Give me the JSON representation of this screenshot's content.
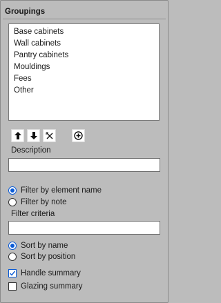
{
  "groupings": {
    "title": "Groupings",
    "items": [
      "Base cabinets",
      "Wall cabinets",
      "Pantry cabinets",
      "Mouldings",
      "Fees",
      "Other"
    ]
  },
  "toolbar": {
    "up_icon": "arrow-up-icon",
    "down_icon": "arrow-down-icon",
    "delete_icon": "delete-x-icon",
    "add_icon": "plus-circle-icon"
  },
  "description": {
    "label": "Description",
    "value": ""
  },
  "filter_mode": {
    "options": [
      "Filter by element name",
      "Filter by note"
    ],
    "selected": "Filter by element name"
  },
  "filter_criteria": {
    "label": "Filter criteria",
    "value": ""
  },
  "sort_mode": {
    "options": [
      "Sort by name",
      "Sort by position"
    ],
    "selected": "Sort by name"
  },
  "summaries": {
    "handle": {
      "label": "Handle summary",
      "checked": true
    },
    "glazing": {
      "label": "Glazing summary",
      "checked": false
    }
  },
  "colors": {
    "accent": "#0a5bd6",
    "panel_bg": "#bcbcbc"
  }
}
